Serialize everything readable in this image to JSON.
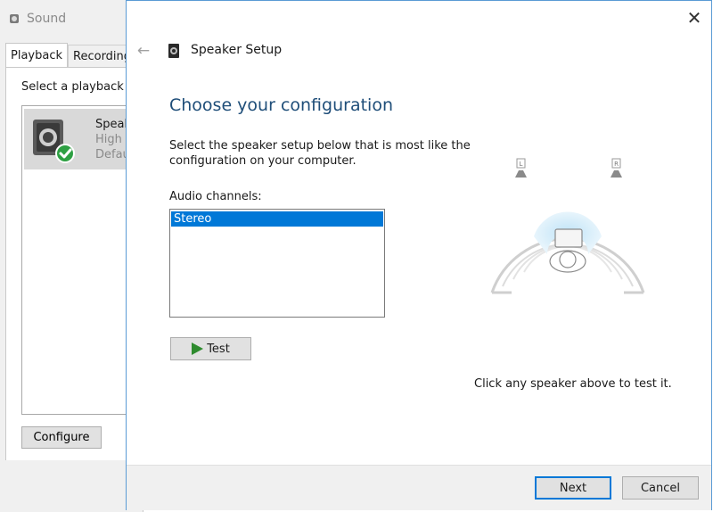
{
  "sound_window": {
    "title": "Sound",
    "tabs": [
      {
        "label": "Playback",
        "active": true
      },
      {
        "label": "Recording",
        "active": false
      }
    ],
    "select_label": "Select a playback d",
    "device": {
      "name": "Speak",
      "desc1": "High D",
      "desc2": "Defau"
    },
    "configure_label": "Configure"
  },
  "wizard": {
    "title": "Speaker Setup",
    "heading": "Choose your configuration",
    "description": "Select the speaker setup below that is most like the configuration on your computer.",
    "channels_label": "Audio channels:",
    "channels": [
      {
        "label": "Stereo",
        "selected": true
      }
    ],
    "test_label": "Test",
    "hint": "Click any speaker above to test it.",
    "speaker_left_label": "L",
    "speaker_right_label": "R",
    "next_label": "Next",
    "cancel_label": "Cancel"
  },
  "colors": {
    "accent": "#0078d7",
    "heading": "#1f4e79",
    "play": "#2e8b2e",
    "check": "#2ea043"
  }
}
